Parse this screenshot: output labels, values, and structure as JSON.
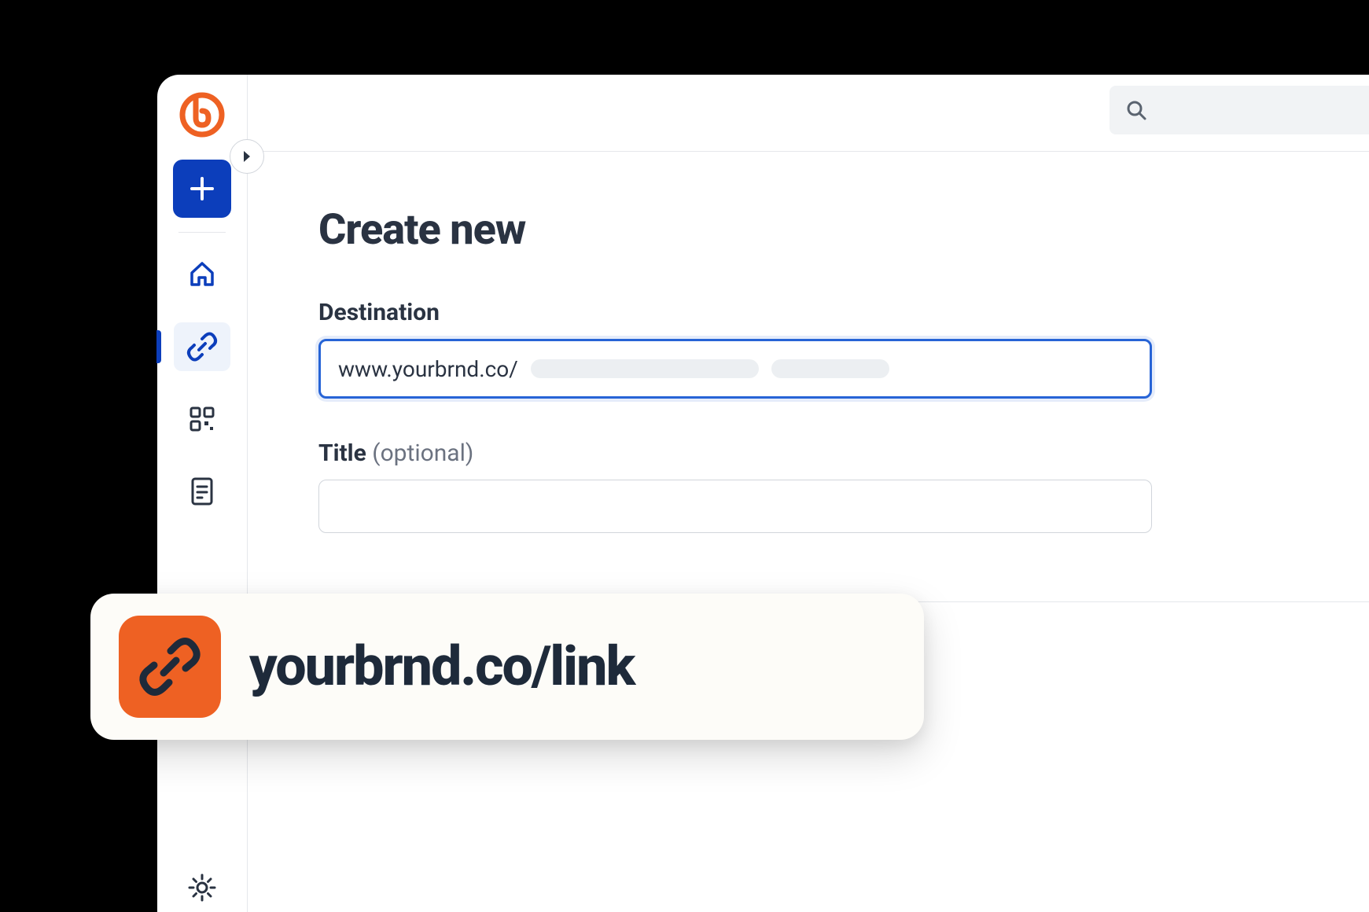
{
  "page": {
    "title": "Create new"
  },
  "form": {
    "destination": {
      "label": "Destination",
      "value": "www.yourbrnd.co/"
    },
    "title": {
      "label": "Title",
      "hint": "(optional)",
      "value": ""
    }
  },
  "shortlink": {
    "display": "yourbrnd.co/link"
  }
}
